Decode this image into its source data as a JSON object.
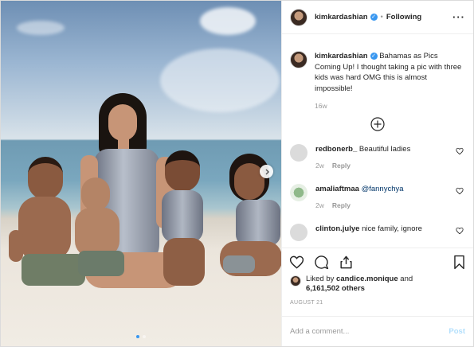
{
  "post": {
    "username": "kimkardashian",
    "follow_label": "Following",
    "caption_text": "Bahamas as Pics Coming Up! I thought taking a pic with three kids was hard OMG this is almost impossible!",
    "caption_time": "16w",
    "date": "AUGUST 21"
  },
  "comments": [
    {
      "username": "redbonerb_",
      "text": "Beautiful ladies",
      "time": "2w",
      "reply_label": "Reply"
    },
    {
      "username": "amaliaftmaa",
      "mention": "@fannychya",
      "time": "2w",
      "reply_label": "Reply"
    },
    {
      "username": "clinton.julye",
      "text": "nice family, ignore"
    }
  ],
  "likes": {
    "prefix": "Liked by",
    "user": "candice.monique",
    "and": "and",
    "count": "6,161,502 others"
  },
  "comment_box": {
    "placeholder": "Add a comment...",
    "post_label": "Post"
  },
  "carousel": {
    "total": 2,
    "current": 1
  },
  "colors": {
    "accent": "#3897f0",
    "text": "#262626",
    "muted": "#999999",
    "post_disabled": "#b2dffc"
  },
  "icons": [
    "more-icon",
    "verified-icon",
    "add-icon",
    "heart-icon",
    "comment-icon",
    "share-icon",
    "bookmark-icon",
    "chevron-right-icon"
  ]
}
